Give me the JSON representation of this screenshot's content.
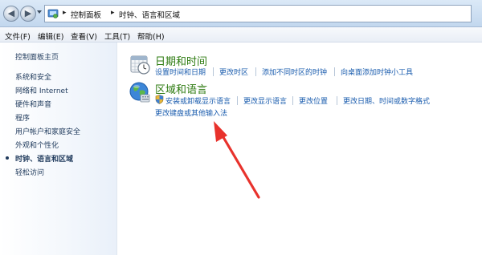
{
  "address": {
    "crumbs": [
      "控制面板",
      "时钟、语言和区域"
    ]
  },
  "menu": [
    "文件(F)",
    "编辑(E)",
    "查看(V)",
    "工具(T)",
    "帮助(H)"
  ],
  "sidebar": {
    "home": "控制面板主页",
    "items": [
      "系统和安全",
      "网络和 Internet",
      "硬件和声音",
      "程序",
      "用户帐户和家庭安全",
      "外观和个性化",
      "时钟、语言和区域",
      "轻松访问"
    ]
  },
  "categories": {
    "datetime": {
      "title": "日期和时间",
      "links": [
        "设置时间和日期",
        "更改时区",
        "添加不同时区的时钟",
        "向桌面添加时钟小工具"
      ]
    },
    "region": {
      "title": "区域和语言",
      "links": [
        "安装或卸载显示语言",
        "更改显示语言",
        "更改位置",
        "更改日期、时间或数字格式",
        "更改键盘或其他输入法"
      ]
    }
  },
  "colors": {
    "link": "#1a5cae",
    "category_title": "#2d7b10",
    "annotation_arrow": "#e8322c"
  }
}
